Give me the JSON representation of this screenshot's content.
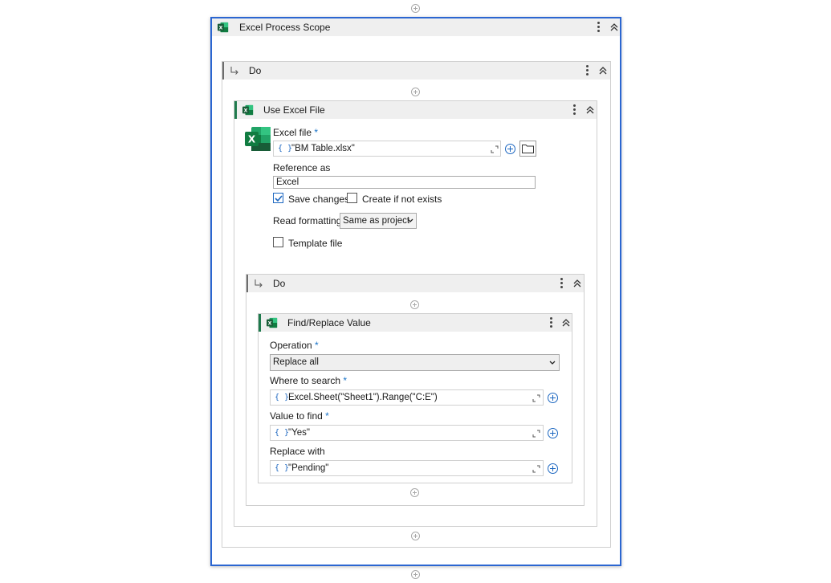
{
  "outer_scope": {
    "title": "Excel Process Scope"
  },
  "do_outer": {
    "title": "Do"
  },
  "use_excel_file": {
    "title": "Use Excel File",
    "excel_file_label": "Excel file",
    "required_mark": "*",
    "excel_file_value": "\"BM Table.xlsx\"",
    "reference_as_label": "Reference as",
    "reference_as_value": "Excel",
    "save_changes_label": "Save changes",
    "save_changes_checked": true,
    "create_if_not_exists_label": "Create if not exists",
    "create_if_not_exists_checked": false,
    "read_formatting_label": "Read formatting",
    "read_formatting_value": "Same as project",
    "template_file_label": "Template file",
    "template_file_checked": false
  },
  "do_inner": {
    "title": "Do"
  },
  "find_replace": {
    "title": "Find/Replace Value",
    "operation_label": "Operation",
    "operation_value": "Replace all",
    "where_to_search_label": "Where to search",
    "where_to_search_value": "Excel.Sheet(\"Sheet1\").Range(\"C:E\")",
    "value_to_find_label": "Value to find",
    "value_to_find_value": "\"Yes\"",
    "replace_with_label": "Replace with",
    "replace_with_value": "\"Pending\""
  },
  "icons": {
    "expression_brace": "{ }",
    "excel": "excel-icon",
    "kebab": "kebab-menu-icon",
    "collapse": "collapse-chevron-icon",
    "add": "add-circle-icon",
    "expand": "expand-editor-icon",
    "folder": "folder-icon",
    "do_arrow": "do-arrow-icon"
  },
  "colors": {
    "selection_border": "#2b66d1",
    "excel_green": "#107c41",
    "activity_accent": "#1f7a4d",
    "header_bg": "#efefef",
    "link_blue": "#1b66c0"
  }
}
